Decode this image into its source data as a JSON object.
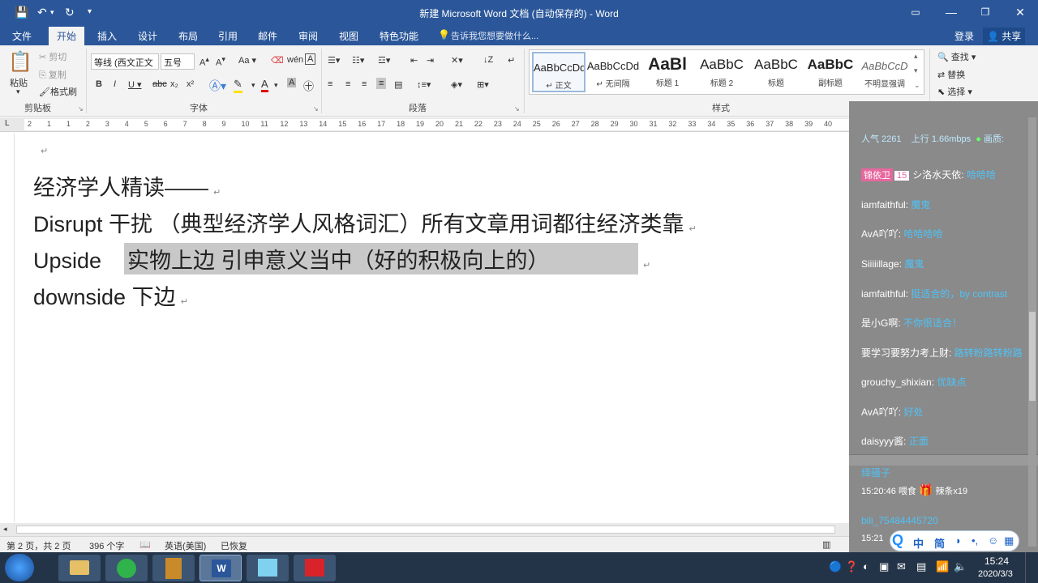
{
  "window": {
    "title": "新建 Microsoft Word 文档 (自动保存的) - Word"
  },
  "tabs": [
    "文件",
    "开始",
    "插入",
    "设计",
    "布局",
    "引用",
    "邮件",
    "审阅",
    "视图",
    "特色功能"
  ],
  "tellme": "告诉我您想要做什么...",
  "account": {
    "login": "登录",
    "share": "共享"
  },
  "clipboard": {
    "paste": "粘贴",
    "cut": "剪切",
    "copy": "复制",
    "format_painter": "格式刷",
    "group": "剪贴板"
  },
  "font": {
    "name": "等线 (西文正文",
    "size": "五号",
    "group": "字体"
  },
  "paragraph": {
    "group": "段落"
  },
  "styles": {
    "group": "样式",
    "items": [
      {
        "preview": "AaBbCcDd",
        "name": "↵ 正文"
      },
      {
        "preview": "AaBbCcDd",
        "name": "↵ 无间隔"
      },
      {
        "preview": "AaBl",
        "name": "标题 1"
      },
      {
        "preview": "AaBbC",
        "name": "标题 2"
      },
      {
        "preview": "AaBbC",
        "name": "标题"
      },
      {
        "preview": "AaBbC",
        "name": "副标题"
      },
      {
        "preview": "AaBbCcD",
        "name": "不明显强调"
      }
    ]
  },
  "editing": {
    "find": "查找",
    "replace": "替换",
    "select": "选择",
    "group": "编辑"
  },
  "ruler_numbers": [
    "2",
    "1",
    "1",
    "2",
    "3",
    "4",
    "5",
    "6",
    "7",
    "8",
    "9",
    "10",
    "11",
    "12",
    "13",
    "14",
    "15",
    "16",
    "17",
    "18",
    "19",
    "20",
    "21",
    "22",
    "23",
    "24",
    "25",
    "26",
    "27",
    "28",
    "29",
    "30",
    "31",
    "32",
    "33",
    "34",
    "35",
    "36",
    "37",
    "38",
    "39",
    "40"
  ],
  "doc": {
    "lines": [
      {
        "text": "经济学人精读——",
        "rest": ""
      },
      {
        "text": "Disrupt    干扰       （典型经济学人风格词汇）所有文章用词都往经济类靠",
        "rest": ""
      },
      {
        "text": "Upside",
        "rest": " 实物上边  引申意义当中（好的积极向上的）"
      },
      {
        "text": "downside    下边",
        "rest": ""
      }
    ]
  },
  "status": {
    "page": "第 2 页，共 2 页",
    "words": "396 个字",
    "lang": "英语(美国)",
    "recovered": "已恢复"
  },
  "chat": {
    "stats": {
      "popularity": "人气  2261",
      "upload": "上行  1.66mbps",
      "quality": "画质:"
    },
    "messages": [
      {
        "user": "シ洛水天依:",
        "text": "哈哈哈",
        "badge": "锦依卫",
        "level": "15"
      },
      {
        "user": "iamfaithful:",
        "text": "魔鬼"
      },
      {
        "user": "AvA吖吖:",
        "text": "哈哈哈哈"
      },
      {
        "user": "Siiiiillage:",
        "text": "魔鬼"
      },
      {
        "user": "iamfaithful:",
        "text": "挺适合的，by contrast"
      },
      {
        "user": "是小G啊:",
        "text": "不你很适合！"
      },
      {
        "user": "要学习要努力考上财:",
        "text": "路转粉路转粉路"
      },
      {
        "user": "grouchy_shixian:",
        "text": "优缺点"
      },
      {
        "user": "AvA吖吖:",
        "text": "好处"
      },
      {
        "user": "daisyyy酱:",
        "text": "正面"
      }
    ],
    "gift": {
      "user": "绎骚子",
      "time": "15:20:46 喂食",
      "item": "辣条x19"
    },
    "last_user": "bili_75484445720",
    "last_time": "15:21"
  },
  "qqbar": {
    "items": [
      "中",
      "简"
    ]
  },
  "clock": {
    "time": "15:24",
    "date": "2020/3/3"
  }
}
